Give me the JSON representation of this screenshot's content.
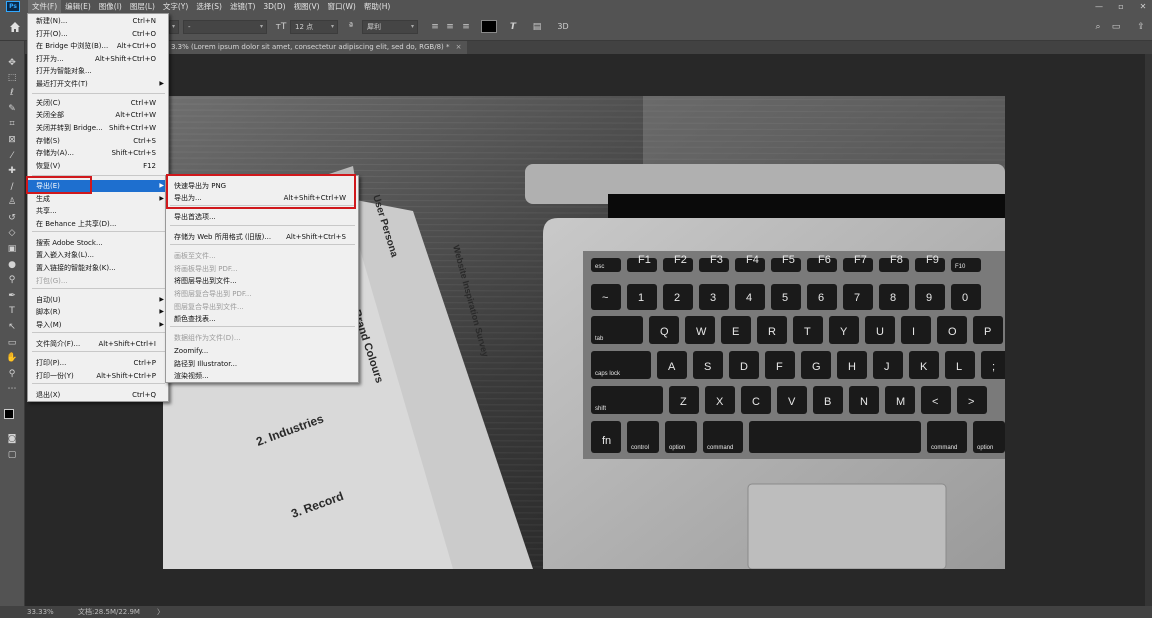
{
  "app": {
    "name": "Photoshop",
    "logo_text": "Ps",
    "menus": [
      "文件(F)",
      "编辑(E)",
      "图像(I)",
      "图层(L)",
      "文字(Y)",
      "选择(S)",
      "滤镜(T)",
      "3D(D)",
      "视图(V)",
      "窗口(W)",
      "帮助(H)"
    ],
    "active_menu": "文件(F)",
    "window_controls": [
      "—",
      "▫",
      "✕"
    ]
  },
  "options_bar": {
    "font_family": "",
    "font_style": "-",
    "font_size": "12 点",
    "antialias": "犀利",
    "3d_label": "3D",
    "text_color": "#000000"
  },
  "document": {
    "tab_title": "3.3% (Lorem ipsum dolor sit amet, consectetur adipiscing elit, sed do, RGB/8) *",
    "close": "×"
  },
  "status": {
    "zoom": "33.33%",
    "doc_info": "文档:28.5M/22.9M",
    "arrow": "〉"
  },
  "file_menu": {
    "items": [
      {
        "label": "新建(N)...",
        "shortcut": "Ctrl+N",
        "state": "normal"
      },
      {
        "label": "打开(O)...",
        "shortcut": "Ctrl+O",
        "state": "normal"
      },
      {
        "label": "在 Bridge 中浏览(B)...",
        "shortcut": "Alt+Ctrl+O",
        "state": "normal"
      },
      {
        "label": "打开为...",
        "shortcut": "Alt+Shift+Ctrl+O",
        "state": "normal"
      },
      {
        "label": "打开为智能对象...",
        "shortcut": "",
        "state": "normal"
      },
      {
        "label": "最近打开文件(T)",
        "shortcut": "",
        "state": "submenu"
      },
      {
        "label": "关闭(C)",
        "shortcut": "Ctrl+W",
        "state": "normal"
      },
      {
        "label": "关闭全部",
        "shortcut": "Alt+Ctrl+W",
        "state": "normal"
      },
      {
        "label": "关闭并转到 Bridge...",
        "shortcut": "Shift+Ctrl+W",
        "state": "normal"
      },
      {
        "label": "存储(S)",
        "shortcut": "Ctrl+S",
        "state": "normal"
      },
      {
        "label": "存储为(A)...",
        "shortcut": "Shift+Ctrl+S",
        "state": "normal"
      },
      {
        "label": "恢复(V)",
        "shortcut": "F12",
        "state": "normal"
      },
      {
        "label": "导出(E)",
        "shortcut": "",
        "state": "highlighted"
      },
      {
        "label": "生成",
        "shortcut": "",
        "state": "submenu"
      },
      {
        "label": "共享...",
        "shortcut": "",
        "state": "normal"
      },
      {
        "label": "在 Behance 上共享(D)...",
        "shortcut": "",
        "state": "normal"
      },
      {
        "label": "搜索 Adobe Stock...",
        "shortcut": "",
        "state": "normal"
      },
      {
        "label": "置入嵌入对象(L)...",
        "shortcut": "",
        "state": "normal"
      },
      {
        "label": "置入链接的智能对象(K)...",
        "shortcut": "",
        "state": "normal"
      },
      {
        "label": "打包(G)...",
        "shortcut": "",
        "state": "disabled"
      },
      {
        "label": "自动(U)",
        "shortcut": "",
        "state": "submenu"
      },
      {
        "label": "脚本(R)",
        "shortcut": "",
        "state": "submenu"
      },
      {
        "label": "导入(M)",
        "shortcut": "",
        "state": "submenu"
      },
      {
        "label": "文件简介(F)...",
        "shortcut": "Alt+Shift+Ctrl+I",
        "state": "normal"
      },
      {
        "label": "打印(P)...",
        "shortcut": "Ctrl+P",
        "state": "normal"
      },
      {
        "label": "打印一份(Y)",
        "shortcut": "Alt+Shift+Ctrl+P",
        "state": "normal"
      },
      {
        "label": "退出(X)",
        "shortcut": "Ctrl+Q",
        "state": "normal"
      }
    ]
  },
  "export_submenu": {
    "items": [
      {
        "label": "快速导出为 PNG",
        "shortcut": "",
        "state": "normal"
      },
      {
        "label": "导出为...",
        "shortcut": "Alt+Shift+Ctrl+W",
        "state": "normal"
      },
      {
        "label": "导出首选项...",
        "shortcut": "",
        "state": "normal"
      },
      {
        "label": "存储为 Web 所用格式 (旧版)...",
        "shortcut": "Alt+Shift+Ctrl+S",
        "state": "normal"
      },
      {
        "label": "画板至文件...",
        "shortcut": "",
        "state": "disabled"
      },
      {
        "label": "将画板导出到 PDF...",
        "shortcut": "",
        "state": "disabled"
      },
      {
        "label": "将图层导出到文件...",
        "shortcut": "",
        "state": "normal"
      },
      {
        "label": "将图层复合导出到 PDF...",
        "shortcut": "",
        "state": "disabled"
      },
      {
        "label": "图层复合导出到文件...",
        "shortcut": "",
        "state": "disabled"
      },
      {
        "label": "颜色查找表...",
        "shortcut": "",
        "state": "normal"
      },
      {
        "label": "数据组作为文件(D)...",
        "shortcut": "",
        "state": "disabled"
      },
      {
        "label": "Zoomify...",
        "shortcut": "",
        "state": "normal"
      },
      {
        "label": "路径到 Illustrator...",
        "shortcut": "",
        "state": "normal"
      },
      {
        "label": "渲染视频...",
        "shortcut": "",
        "state": "normal"
      }
    ]
  },
  "canvas_text": {
    "paper1_title": "User Persona",
    "paper2_title": "Website Inspiration Survey",
    "paper3_title": "Brand Colours",
    "section2": "2. Industries",
    "section3": "3. Record",
    "key_rows": [
      [
        "esc",
        "F1",
        "F2",
        "F3",
        "F4",
        "F5",
        "F6",
        "F7",
        "F8",
        "F9",
        "F10"
      ],
      [
        "~",
        "1",
        "2",
        "3",
        "4",
        "5",
        "6",
        "7",
        "8",
        "9",
        "0"
      ],
      [
        "tab",
        "Q",
        "W",
        "E",
        "R",
        "T",
        "Y",
        "U",
        "I",
        "O",
        "P"
      ],
      [
        "caps lock",
        "A",
        "S",
        "D",
        "F",
        "G",
        "H",
        "J",
        "K",
        "L",
        ";"
      ],
      [
        "shift",
        "Z",
        "X",
        "C",
        "V",
        "B",
        "N",
        "M",
        "<",
        ">"
      ],
      [
        "fn",
        "control",
        "option",
        "command",
        "",
        "command",
        "option"
      ]
    ]
  }
}
